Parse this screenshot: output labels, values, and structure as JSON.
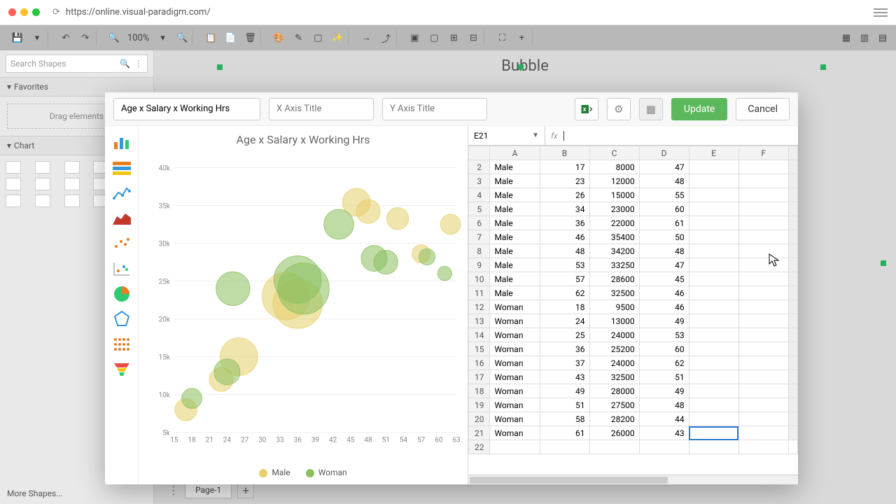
{
  "browser": {
    "url": "https://online.visual-paradigm.com/"
  },
  "toolbar": {
    "zoom": "100%"
  },
  "leftPanel": {
    "searchPlaceholder": "Search Shapes",
    "favorites": "Favorites",
    "dragHint": "Drag elements",
    "chart": "Chart",
    "moreShapes": "More Shapes..."
  },
  "canvas": {
    "chartLabel": "Bubble",
    "pageTab": "Page-1"
  },
  "dialog": {
    "chartTitleValue": "Age x Salary x Working Hrs",
    "xAxisPlaceholder": "X Axis Title",
    "yAxisPlaceholder": "Y Axis Title",
    "updateLabel": "Update",
    "cancelLabel": "Cancel",
    "chartTitleText": "Age x Salary x Working Hrs"
  },
  "legend": {
    "male": "Male",
    "woman": "Woman"
  },
  "sheet": {
    "cellRef": "E21",
    "fx": "fx",
    "cols": [
      "A",
      "B",
      "C",
      "D",
      "E",
      "F"
    ],
    "rows": [
      {
        "n": 2,
        "a": "Male",
        "b": 17,
        "c": 8000,
        "d": 47
      },
      {
        "n": 3,
        "a": "Male",
        "b": 23,
        "c": 12000,
        "d": 48
      },
      {
        "n": 4,
        "a": "Male",
        "b": 26,
        "c": 15000,
        "d": 55
      },
      {
        "n": 5,
        "a": "Male",
        "b": 34,
        "c": 23000,
        "d": 60
      },
      {
        "n": 6,
        "a": "Male",
        "b": 36,
        "c": 22000,
        "d": 61
      },
      {
        "n": 7,
        "a": "Male",
        "b": 46,
        "c": 35400,
        "d": 50
      },
      {
        "n": 8,
        "a": "Male",
        "b": 48,
        "c": 34200,
        "d": 48
      },
      {
        "n": 9,
        "a": "Male",
        "b": 53,
        "c": 33250,
        "d": 47
      },
      {
        "n": 10,
        "a": "Male",
        "b": 57,
        "c": 28600,
        "d": 45
      },
      {
        "n": 11,
        "a": "Male",
        "b": 62,
        "c": 32500,
        "d": 46
      },
      {
        "n": 12,
        "a": "Woman",
        "b": 18,
        "c": 9500,
        "d": 46
      },
      {
        "n": 13,
        "a": "Woman",
        "b": 24,
        "c": 13000,
        "d": 49
      },
      {
        "n": 14,
        "a": "Woman",
        "b": 25,
        "c": 24000,
        "d": 53
      },
      {
        "n": 15,
        "a": "Woman",
        "b": 36,
        "c": 25200,
        "d": 60
      },
      {
        "n": 16,
        "a": "Woman",
        "b": 37,
        "c": 24000,
        "d": 62
      },
      {
        "n": 17,
        "a": "Woman",
        "b": 43,
        "c": 32500,
        "d": 51
      },
      {
        "n": 18,
        "a": "Woman",
        "b": 49,
        "c": 28000,
        "d": 49
      },
      {
        "n": 19,
        "a": "Woman",
        "b": 51,
        "c": 27500,
        "d": 48
      },
      {
        "n": 20,
        "a": "Woman",
        "b": 58,
        "c": 28200,
        "d": 44
      },
      {
        "n": 21,
        "a": "Woman",
        "b": 61,
        "c": 26000,
        "d": 43
      }
    ]
  },
  "chart_data": {
    "type": "scatter",
    "title": "Age x Salary x Working Hrs",
    "xlabel": "",
    "ylabel": "",
    "xlim": [
      15,
      63
    ],
    "ylim": [
      5000,
      40000
    ],
    "xticks": [
      15,
      18,
      21,
      24,
      27,
      30,
      33,
      36,
      39,
      42,
      45,
      48,
      51,
      54,
      57,
      60,
      63
    ],
    "yticks": [
      5000,
      10000,
      15000,
      20000,
      25000,
      30000,
      35000,
      40000
    ],
    "yticklabels": [
      "5k",
      "10k",
      "15k",
      "20k",
      "25k",
      "30k",
      "35k",
      "40k"
    ],
    "series": [
      {
        "name": "Male",
        "color": "#e6d06b",
        "points": [
          {
            "x": 17,
            "y": 8000,
            "size": 47
          },
          {
            "x": 23,
            "y": 12000,
            "size": 48
          },
          {
            "x": 26,
            "y": 15000,
            "size": 55
          },
          {
            "x": 34,
            "y": 23000,
            "size": 60
          },
          {
            "x": 36,
            "y": 22000,
            "size": 61
          },
          {
            "x": 46,
            "y": 35400,
            "size": 50
          },
          {
            "x": 48,
            "y": 34200,
            "size": 48
          },
          {
            "x": 53,
            "y": 33250,
            "size": 47
          },
          {
            "x": 57,
            "y": 28600,
            "size": 45
          },
          {
            "x": 62,
            "y": 32500,
            "size": 46
          }
        ]
      },
      {
        "name": "Woman",
        "color": "#8bbf5e",
        "points": [
          {
            "x": 18,
            "y": 9500,
            "size": 46
          },
          {
            "x": 24,
            "y": 13000,
            "size": 49
          },
          {
            "x": 25,
            "y": 24000,
            "size": 53
          },
          {
            "x": 36,
            "y": 25200,
            "size": 60
          },
          {
            "x": 37,
            "y": 24000,
            "size": 62
          },
          {
            "x": 43,
            "y": 32500,
            "size": 51
          },
          {
            "x": 49,
            "y": 28000,
            "size": 49
          },
          {
            "x": 51,
            "y": 27500,
            "size": 48
          },
          {
            "x": 58,
            "y": 28200,
            "size": 44
          },
          {
            "x": 61,
            "y": 26000,
            "size": 43
          }
        ]
      }
    ]
  }
}
